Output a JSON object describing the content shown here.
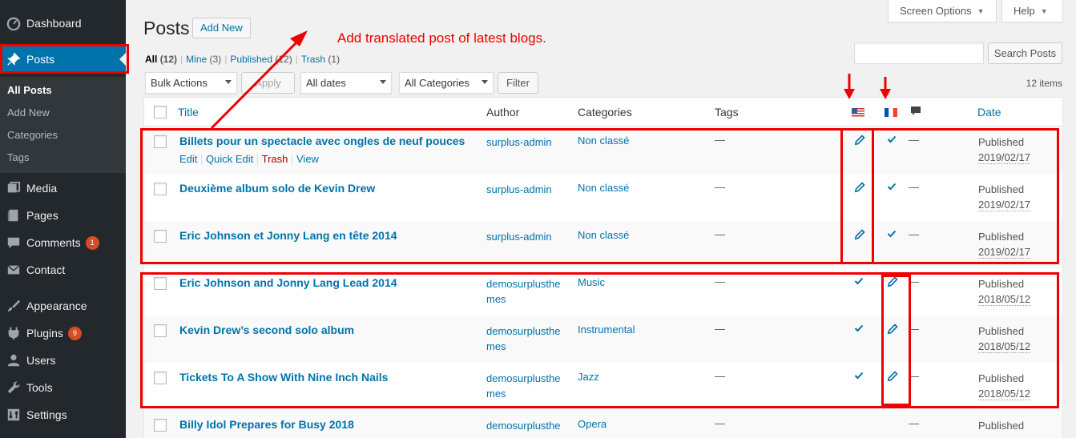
{
  "sidebar": {
    "items": [
      {
        "label": "Dashboard",
        "icon": "dashboard-icon"
      },
      {
        "label": "Posts",
        "icon": "pin-icon"
      },
      {
        "label": "Media",
        "icon": "media-icon"
      },
      {
        "label": "Pages",
        "icon": "pages-icon"
      },
      {
        "label": "Comments",
        "icon": "comments-icon",
        "badge": "1"
      },
      {
        "label": "Contact",
        "icon": "mail-icon"
      },
      {
        "label": "Appearance",
        "icon": "brush-icon"
      },
      {
        "label": "Plugins",
        "icon": "plugin-icon",
        "badge": "9"
      },
      {
        "label": "Users",
        "icon": "users-icon"
      },
      {
        "label": "Tools",
        "icon": "wrench-icon"
      },
      {
        "label": "Settings",
        "icon": "settings-icon"
      }
    ],
    "submenu": [
      "All Posts",
      "Add New",
      "Categories",
      "Tags"
    ]
  },
  "header": {
    "title": "Posts",
    "add_new": "Add New",
    "screen_options": "Screen Options",
    "help": "Help"
  },
  "annotation": "Add translated post of latest blogs.",
  "filters_links": {
    "all": "All",
    "all_count": "(12)",
    "mine": "Mine",
    "mine_count": "(3)",
    "published": "Published",
    "published_count": "(12)",
    "trash": "Trash",
    "trash_count": "(1)"
  },
  "search": {
    "button": "Search Posts",
    "value": ""
  },
  "toolbar": {
    "bulk_actions": "Bulk Actions",
    "apply": "Apply",
    "all_dates": "All dates",
    "all_categories": "All Categories",
    "filter": "Filter",
    "items_count": "12 items"
  },
  "table": {
    "headers": {
      "title": "Title",
      "author": "Author",
      "categories": "Categories",
      "tags": "Tags",
      "date": "Date"
    },
    "row_actions": {
      "edit": "Edit",
      "quick_edit": "Quick Edit",
      "trash": "Trash",
      "view": "View"
    },
    "rows": [
      {
        "title": "Billets pour un spectacle avec ongles de neuf pouces",
        "author": "surplus-admin",
        "category": "Non classé",
        "tags": "—",
        "lang_en": "pencil",
        "lang_fr": "check",
        "comments": "—",
        "status": "Published",
        "date": "2019/02/17"
      },
      {
        "title": "Deuxième album solo de Kevin Drew",
        "author": "surplus-admin",
        "category": "Non classé",
        "tags": "—",
        "lang_en": "pencil",
        "lang_fr": "check",
        "comments": "—",
        "status": "Published",
        "date": "2019/02/17"
      },
      {
        "title": "Eric Johnson et Jonny Lang en tête 2014",
        "author": "surplus-admin",
        "category": "Non classé",
        "tags": "—",
        "lang_en": "pencil",
        "lang_fr": "check",
        "comments": "—",
        "status": "Published",
        "date": "2019/02/17"
      },
      {
        "title": "Eric Johnson and Jonny Lang Lead 2014",
        "author": "demosurplusthemes",
        "category": "Music",
        "tags": "—",
        "lang_en": "check",
        "lang_fr": "pencil",
        "comments": "—",
        "status": "Published",
        "date": "2018/05/12"
      },
      {
        "title": "Kevin Drew’s second solo album",
        "author": "demosurplusthemes",
        "category": "Instrumental",
        "tags": "—",
        "lang_en": "check",
        "lang_fr": "pencil",
        "comments": "—",
        "status": "Published",
        "date": "2018/05/12"
      },
      {
        "title": "Tickets To A Show With Nine Inch Nails",
        "author": "demosurplusthemes",
        "category": "Jazz",
        "tags": "—",
        "lang_en": "check",
        "lang_fr": "pencil",
        "comments": "—",
        "status": "Published",
        "date": "2018/05/12"
      },
      {
        "title": "Billy Idol Prepares for Busy 2018",
        "author": "demosurplusthe",
        "category": "Opera",
        "tags": "—",
        "lang_en": "",
        "lang_fr": "",
        "comments": "—",
        "status": "Published",
        "date": ""
      }
    ]
  },
  "colors": {
    "accent": "#0073aa",
    "annotation": "#ee0000",
    "sidebar": "#23282d"
  }
}
